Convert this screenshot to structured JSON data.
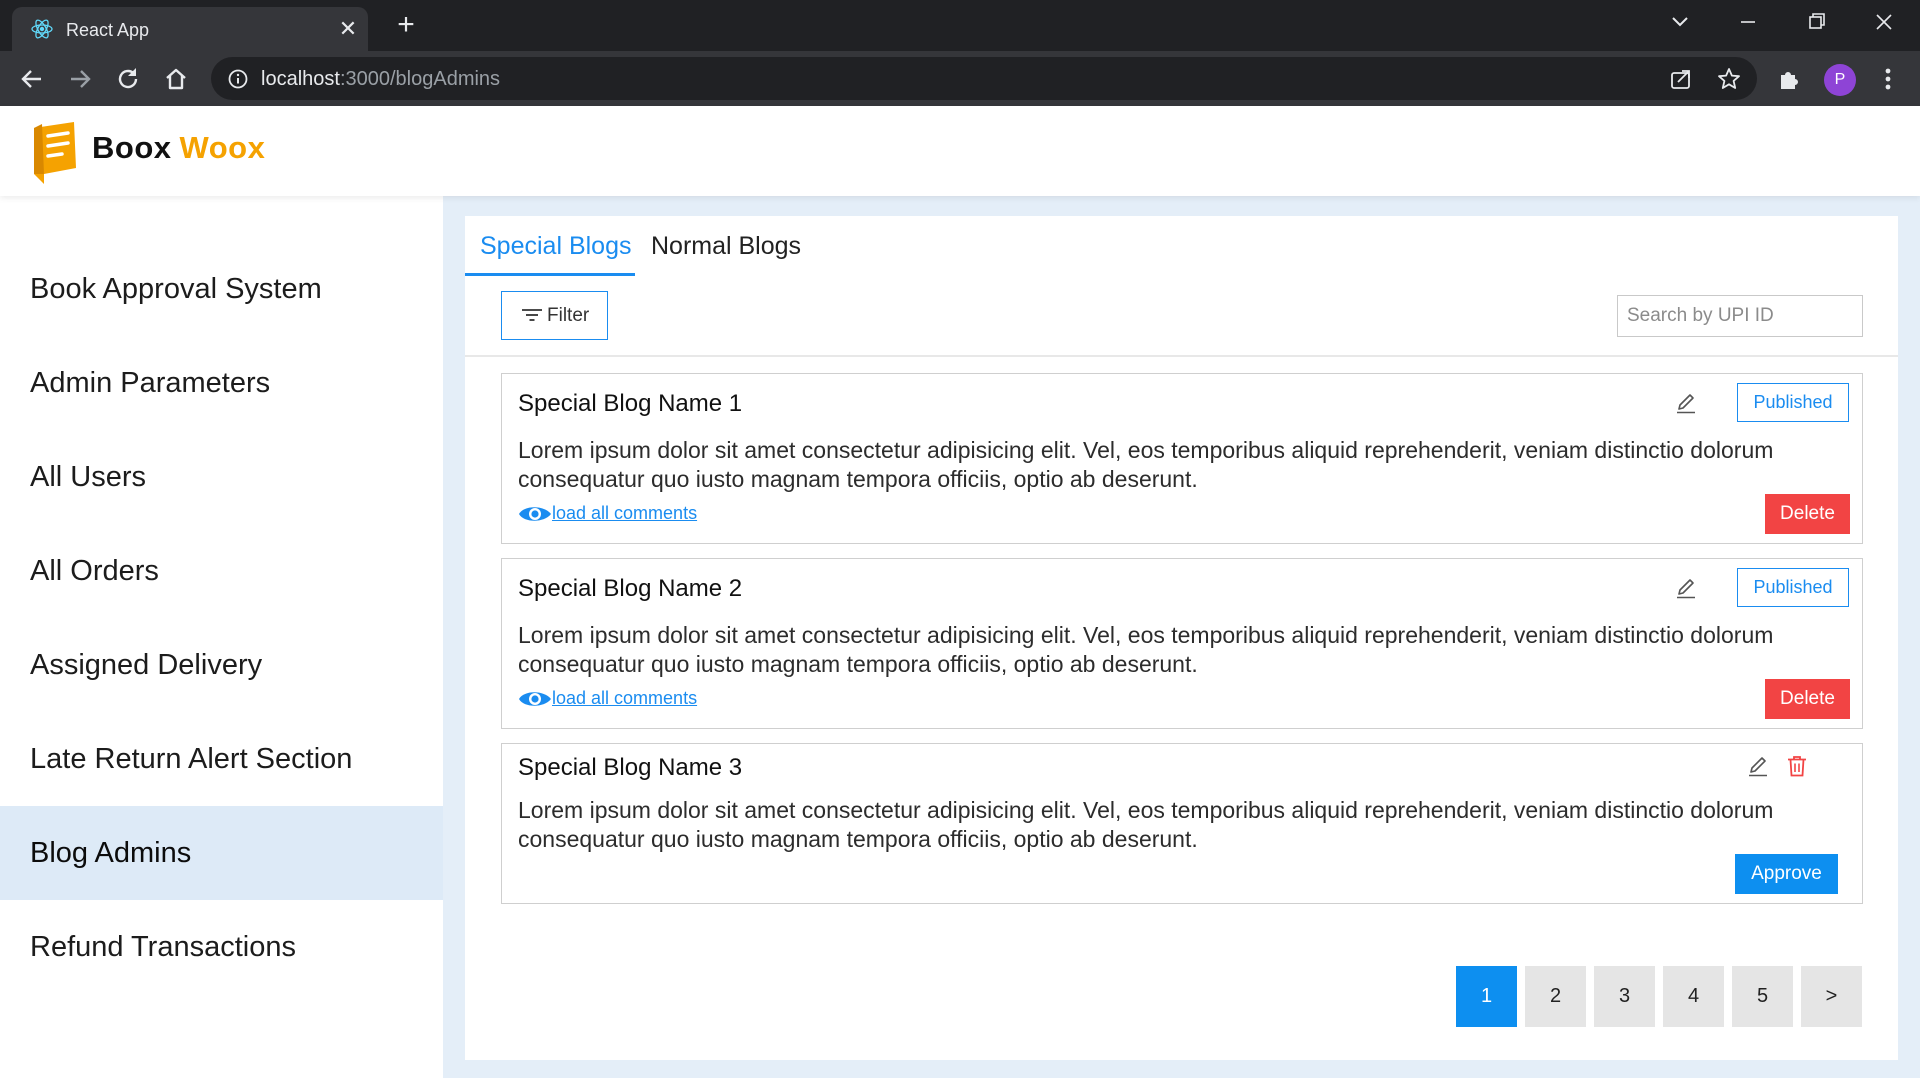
{
  "browser": {
    "tab_title": "React App",
    "url_host": "localhost",
    "url_path": ":3000/blogAdmins",
    "profile_initial": "P"
  },
  "brand": {
    "part1": "Boox",
    "part2": "Woox",
    "colors": {
      "dark": "#111111",
      "accent": "#f5a201"
    }
  },
  "sidebar": {
    "items": [
      {
        "label": "Book Approval System",
        "active": false
      },
      {
        "label": "Admin Parameters",
        "active": false
      },
      {
        "label": "All Users",
        "active": false
      },
      {
        "label": "All Orders",
        "active": false
      },
      {
        "label": "Assigned Delivery",
        "active": false
      },
      {
        "label": "Late Return Alert Section",
        "active": false
      },
      {
        "label": "Blog Admins",
        "active": true
      },
      {
        "label": "Refund Transactions",
        "active": false
      }
    ]
  },
  "tabs": [
    {
      "label": "Special Blogs",
      "active": true
    },
    {
      "label": "Normal Blogs",
      "active": false
    }
  ],
  "filter": {
    "label": "Filter"
  },
  "search": {
    "placeholder": "Search by UPI ID",
    "value": ""
  },
  "blogs": [
    {
      "title": "Special Blog Name 1",
      "body": "Lorem ipsum dolor sit amet consectetur adipisicing elit. Vel, eos temporibus aliquid reprehenderit, veniam distinctio dolorum consequatur quo iusto magnam tempora officiis, optio ab deserunt.",
      "status": "Published",
      "comments_link": "load all comments",
      "action": "Delete"
    },
    {
      "title": "Special Blog Name 2",
      "body": "Lorem ipsum dolor sit amet consectetur adipisicing elit. Vel, eos temporibus aliquid reprehenderit, veniam distinctio dolorum consequatur quo iusto magnam tempora officiis, optio ab deserunt.",
      "status": "Published",
      "comments_link": "load all comments",
      "action": "Delete"
    },
    {
      "title": "Special Blog Name 3",
      "body": "Lorem ipsum dolor sit amet consectetur adipisicing elit. Vel, eos temporibus aliquid reprehenderit, veniam distinctio dolorum consequatur quo iusto magnam tempora officiis, optio ab deserunt.",
      "action": "Approve"
    }
  ],
  "pagination": {
    "pages": [
      "1",
      "2",
      "3",
      "4",
      "5"
    ],
    "next": ">",
    "current": "1"
  },
  "colors": {
    "primary": "#1a8cf0",
    "danger": "#f24444",
    "approve": "#0d8ff0",
    "sidebar_active": "#ddeaf7",
    "main_bg": "#e4eef8"
  },
  "icons": {
    "tab_favicon": "react-icon",
    "tab_close": "close-icon",
    "new_tab": "plus-icon",
    "back": "arrow-left-icon",
    "forward": "arrow-right-icon",
    "reload": "reload-icon",
    "home": "home-icon",
    "site_info": "info-icon",
    "share": "share-icon",
    "bookmark": "star-icon",
    "extensions": "puzzle-icon",
    "menu": "kebab-menu-icon",
    "filter": "filter-lines-icon",
    "edit": "pencil-icon",
    "delete": "trash-icon",
    "comments": "eye-icon",
    "logo": "book-icon"
  }
}
